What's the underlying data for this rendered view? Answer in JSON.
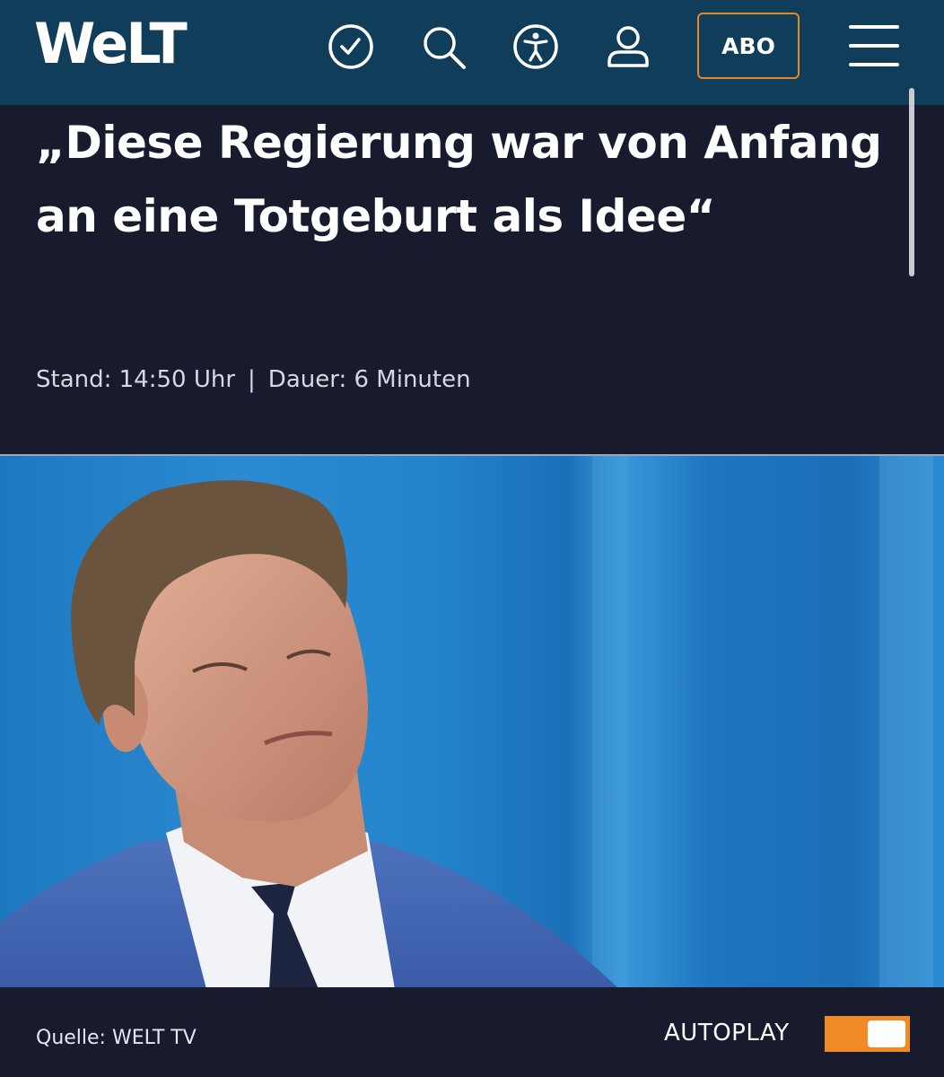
{
  "header": {
    "logo_text": "WeLT",
    "abo_label": "ABO",
    "icons": [
      "clock-icon",
      "search-icon",
      "accessibility-icon",
      "user-icon",
      "menu-icon"
    ]
  },
  "article": {
    "headline": "„Diese Regierung war von Anfang an eine Totgeburt als Idee“",
    "stand": "Stand: 14:50 Uhr",
    "separator": "|",
    "dauer": "Dauer: 6 Minuten"
  },
  "video": {
    "source": "Quelle: WELT TV",
    "autoplay_label": "AUTOPLAY",
    "autoplay_on": true
  },
  "colors": {
    "header_bg": "#0f3d5a",
    "page_bg": "#181a2e",
    "accent": "#e8862a"
  }
}
